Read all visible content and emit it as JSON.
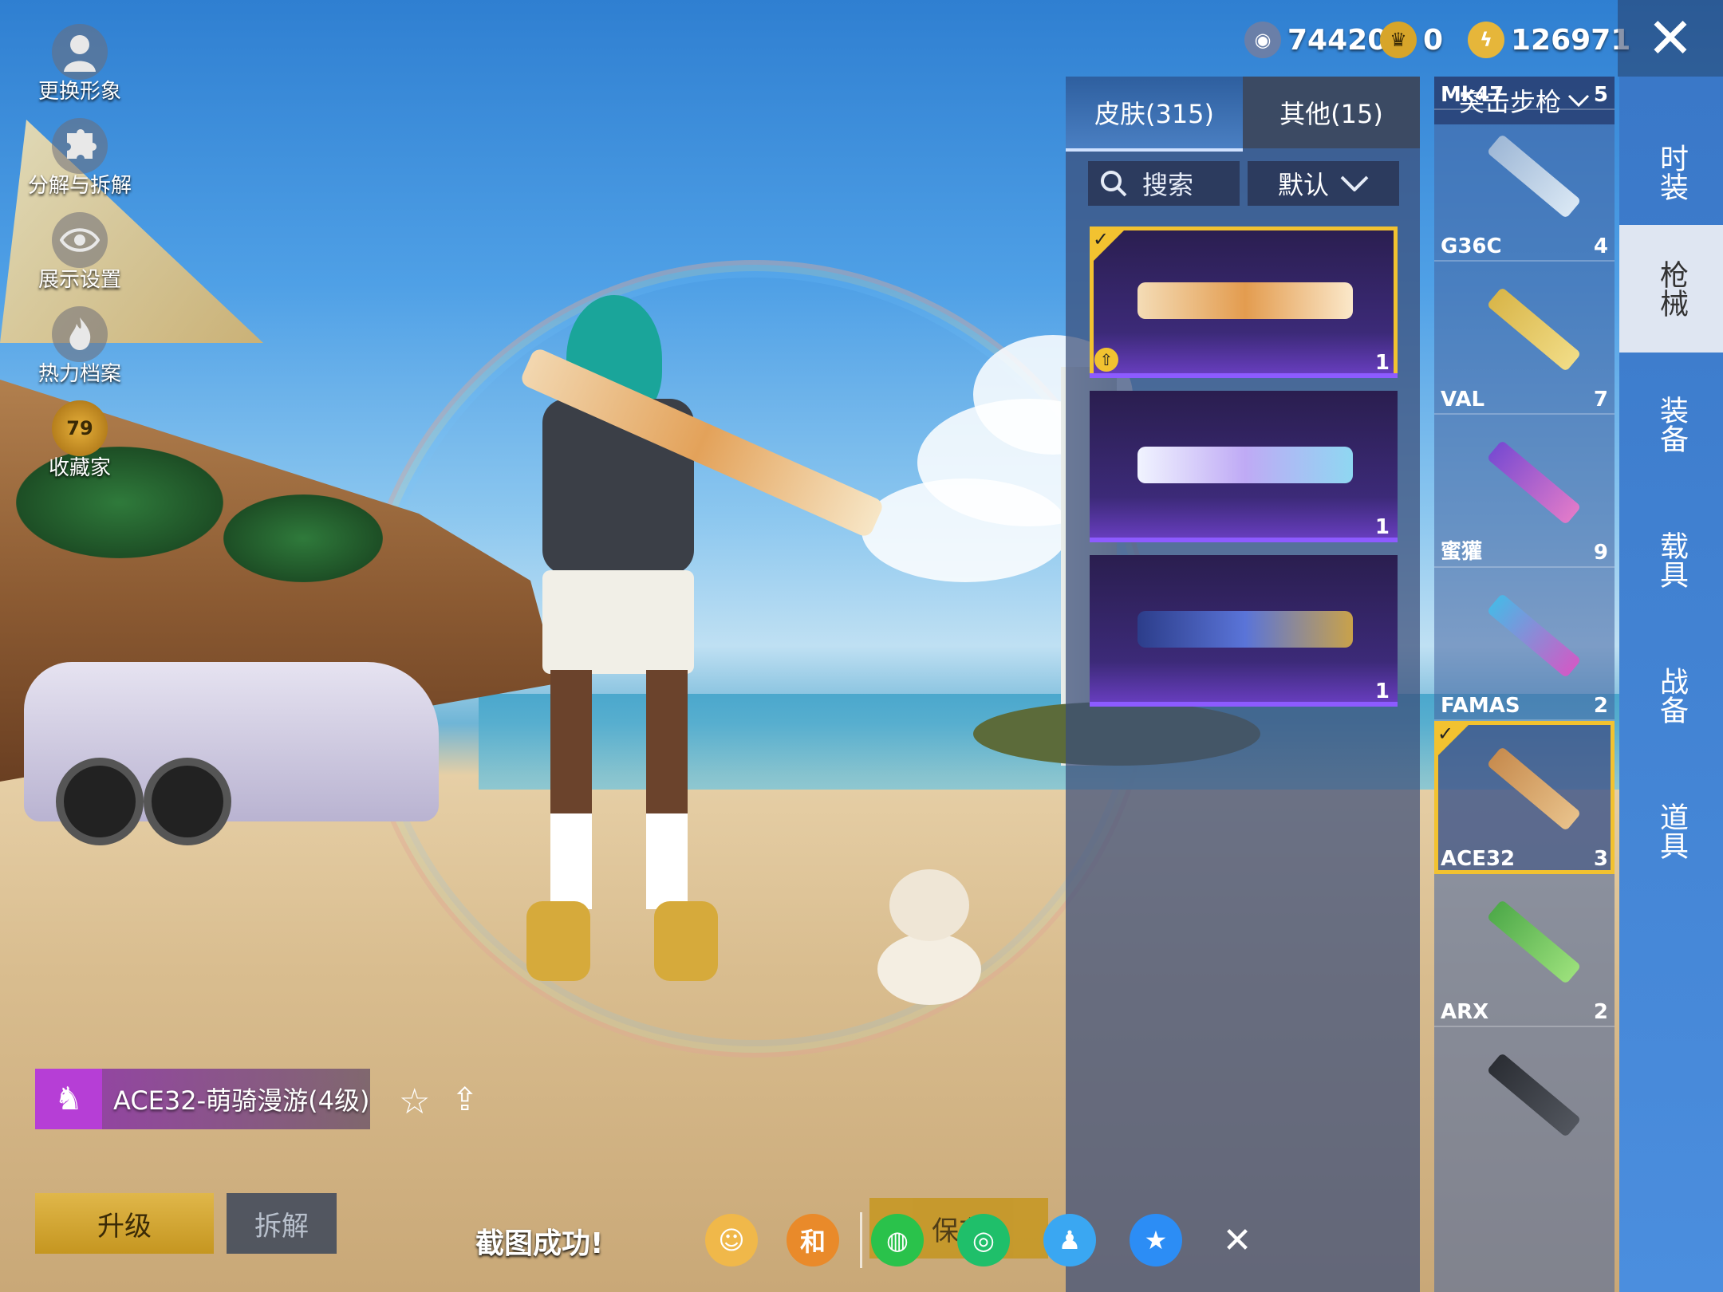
{
  "left_menu": [
    {
      "label": "更换形象",
      "icon": "avatar-icon"
    },
    {
      "label": "分解与拆解",
      "icon": "puzzle-icon"
    },
    {
      "label": "展示设置",
      "icon": "eye-icon"
    },
    {
      "label": "热力档案",
      "icon": "flame-icon"
    },
    {
      "label": "收藏家",
      "icon": "collector-badge-icon",
      "badge": "79"
    }
  ],
  "currency": [
    {
      "value": "74420",
      "icon": "coupon-coin-icon",
      "color": "#6a7fa8"
    },
    {
      "value": "0",
      "icon": "crown-coin-icon",
      "color": "#d7a52a"
    },
    {
      "value": "126971",
      "icon": "lightning-coin-icon",
      "color": "#e6b63a"
    }
  ],
  "close_glyph": "✕",
  "tabs": [
    {
      "label": "皮肤(315)",
      "active": true
    },
    {
      "label": "其他(15)",
      "active": false
    }
  ],
  "search": {
    "label": "搜索",
    "icon": "search-icon"
  },
  "sort": {
    "label": "默认",
    "icon": "chevron-down-icon"
  },
  "skins": [
    {
      "count": "1",
      "selected": true,
      "has_upgrade": true,
      "colors": [
        "#f4dcb6",
        "#e39c4f",
        "#fbe8ca"
      ]
    },
    {
      "count": "1",
      "selected": false,
      "has_upgrade": false,
      "colors": [
        "#f1f4ff",
        "#bfaaf5",
        "#8fd7f2"
      ]
    },
    {
      "count": "1",
      "selected": false,
      "has_upgrade": false,
      "colors": [
        "#2c3d8a",
        "#5a74d8",
        "#c9a24a"
      ]
    }
  ],
  "category": {
    "label": "突击步枪",
    "icon": "chevron-down-icon"
  },
  "weapons": [
    {
      "name": "Mk47",
      "count": "5",
      "colors": [
        "#8b8f9a",
        "#bfc3cc"
      ]
    },
    {
      "name": "G36C",
      "count": "4",
      "colors": [
        "#9fb8d6",
        "#d9e7f4"
      ]
    },
    {
      "name": "VAL",
      "count": "7",
      "colors": [
        "#d9b64a",
        "#f1dc86"
      ]
    },
    {
      "name": "蜜獾",
      "count": "9",
      "colors": [
        "#7a4bd1",
        "#e07ac9"
      ]
    },
    {
      "name": "FAMAS",
      "count": "2",
      "colors": [
        "#4ab7e6",
        "#d05bc6"
      ]
    },
    {
      "name": "ACE32",
      "count": "3",
      "colors": [
        "#c78c4f",
        "#e8c18a"
      ],
      "selected": true
    },
    {
      "name": "ARX",
      "count": "2",
      "colors": [
        "#4faa4a",
        "#9be07b"
      ]
    },
    {
      "name": "",
      "count": "",
      "colors": [
        "#2b2e34",
        "#52565e"
      ]
    }
  ],
  "side_tabs": [
    {
      "label": "时装",
      "active": false
    },
    {
      "label": "枪械",
      "active": true
    },
    {
      "label": "装备",
      "active": false
    },
    {
      "label": "载具",
      "active": false
    },
    {
      "label": "战备",
      "active": false
    },
    {
      "label": "道具",
      "active": false
    }
  ],
  "selected_skin": {
    "name": "ACE32-萌骑漫游(4级)",
    "logo": "horse-logo-icon"
  },
  "actions": {
    "upgrade": "升级",
    "disassemble": "拆解",
    "star_icon": "star-outline-icon",
    "share_icon": "share-icon"
  },
  "screenshot_bar": {
    "message": "截图成功!",
    "save_button": "保存",
    "share_targets": [
      {
        "icon": "profile-share-icon",
        "color": "#f0b84a",
        "glyph": "☺"
      },
      {
        "icon": "game-logo-icon",
        "color": "#e98a2a",
        "glyph": "和"
      },
      {
        "icon": "wechat-icon",
        "color": "#2ac24b",
        "glyph": "◍"
      },
      {
        "icon": "moments-icon",
        "color": "#1fbf6a",
        "glyph": "◎"
      },
      {
        "icon": "qq-icon",
        "color": "#3aa7f2",
        "glyph": "♟"
      },
      {
        "icon": "qzone-icon",
        "color": "#2c8df5",
        "glyph": "★"
      },
      {
        "icon": "close-icon",
        "color": "transparent",
        "glyph": "✕"
      }
    ]
  }
}
